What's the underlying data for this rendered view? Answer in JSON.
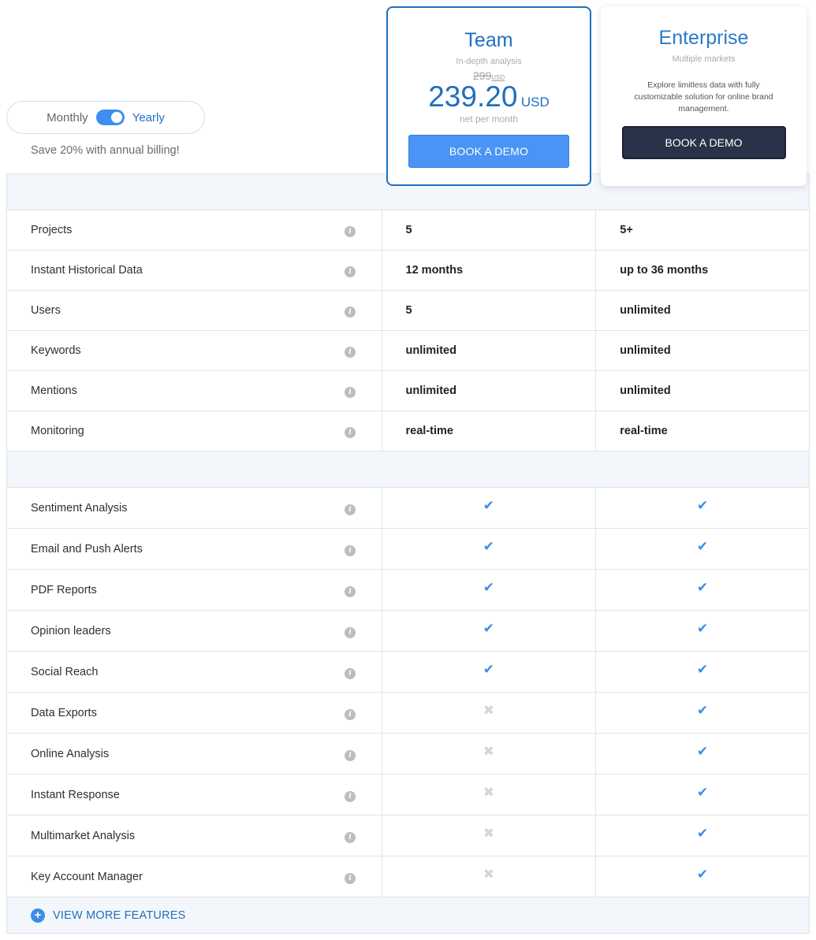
{
  "billing": {
    "monthly_label": "Monthly",
    "yearly_label": "Yearly",
    "selected": "Yearly",
    "save_note": "Save 20% with annual billing!"
  },
  "plans": {
    "team": {
      "name": "Team",
      "subtitle": "In-depth analysis",
      "old_price": "299",
      "old_price_currency": "USD",
      "price": "239.20",
      "currency": "USD",
      "period": "net per month",
      "button": "BOOK A DEMO"
    },
    "enterprise": {
      "name": "Enterprise",
      "subtitle": "Multiple markets",
      "description": "Explore limitless data with fully customizable solution for online brand management.",
      "button": "BOOK A DEMO"
    }
  },
  "limits": [
    {
      "feature": "Projects",
      "team": "5",
      "enterprise": "5+"
    },
    {
      "feature": "Instant Historical Data",
      "team": "12 months",
      "enterprise": "up to 36 months"
    },
    {
      "feature": "Users",
      "team": "5",
      "enterprise": "unlimited"
    },
    {
      "feature": "Keywords",
      "team": "unlimited",
      "enterprise": "unlimited"
    },
    {
      "feature": "Mentions",
      "team": "unlimited",
      "enterprise": "unlimited"
    },
    {
      "feature": "Monitoring",
      "team": "real-time",
      "enterprise": "real-time"
    }
  ],
  "features": [
    {
      "feature": "Sentiment Analysis",
      "team": true,
      "enterprise": true
    },
    {
      "feature": "Email and Push Alerts",
      "team": true,
      "enterprise": true
    },
    {
      "feature": "PDF Reports",
      "team": true,
      "enterprise": true
    },
    {
      "feature": "Opinion leaders",
      "team": true,
      "enterprise": true
    },
    {
      "feature": "Social Reach",
      "team": true,
      "enterprise": true
    },
    {
      "feature": "Data Exports",
      "team": false,
      "enterprise": true
    },
    {
      "feature": "Online Analysis",
      "team": false,
      "enterprise": true
    },
    {
      "feature": "Instant Response",
      "team": false,
      "enterprise": true
    },
    {
      "feature": "Multimarket Analysis",
      "team": false,
      "enterprise": true
    },
    {
      "feature": "Key Account Manager",
      "team": false,
      "enterprise": true
    }
  ],
  "view_more": "VIEW MORE FEATURES",
  "icons": {
    "info": "info-icon",
    "check": "check-icon",
    "cross": "cross-icon",
    "plus": "plus-circle-icon"
  },
  "colors": {
    "accent": "#1f6fbf",
    "button_team": "#4a94f5",
    "button_enterprise": "#283248",
    "check": "#3b8de8",
    "cross": "#d3d7db"
  }
}
